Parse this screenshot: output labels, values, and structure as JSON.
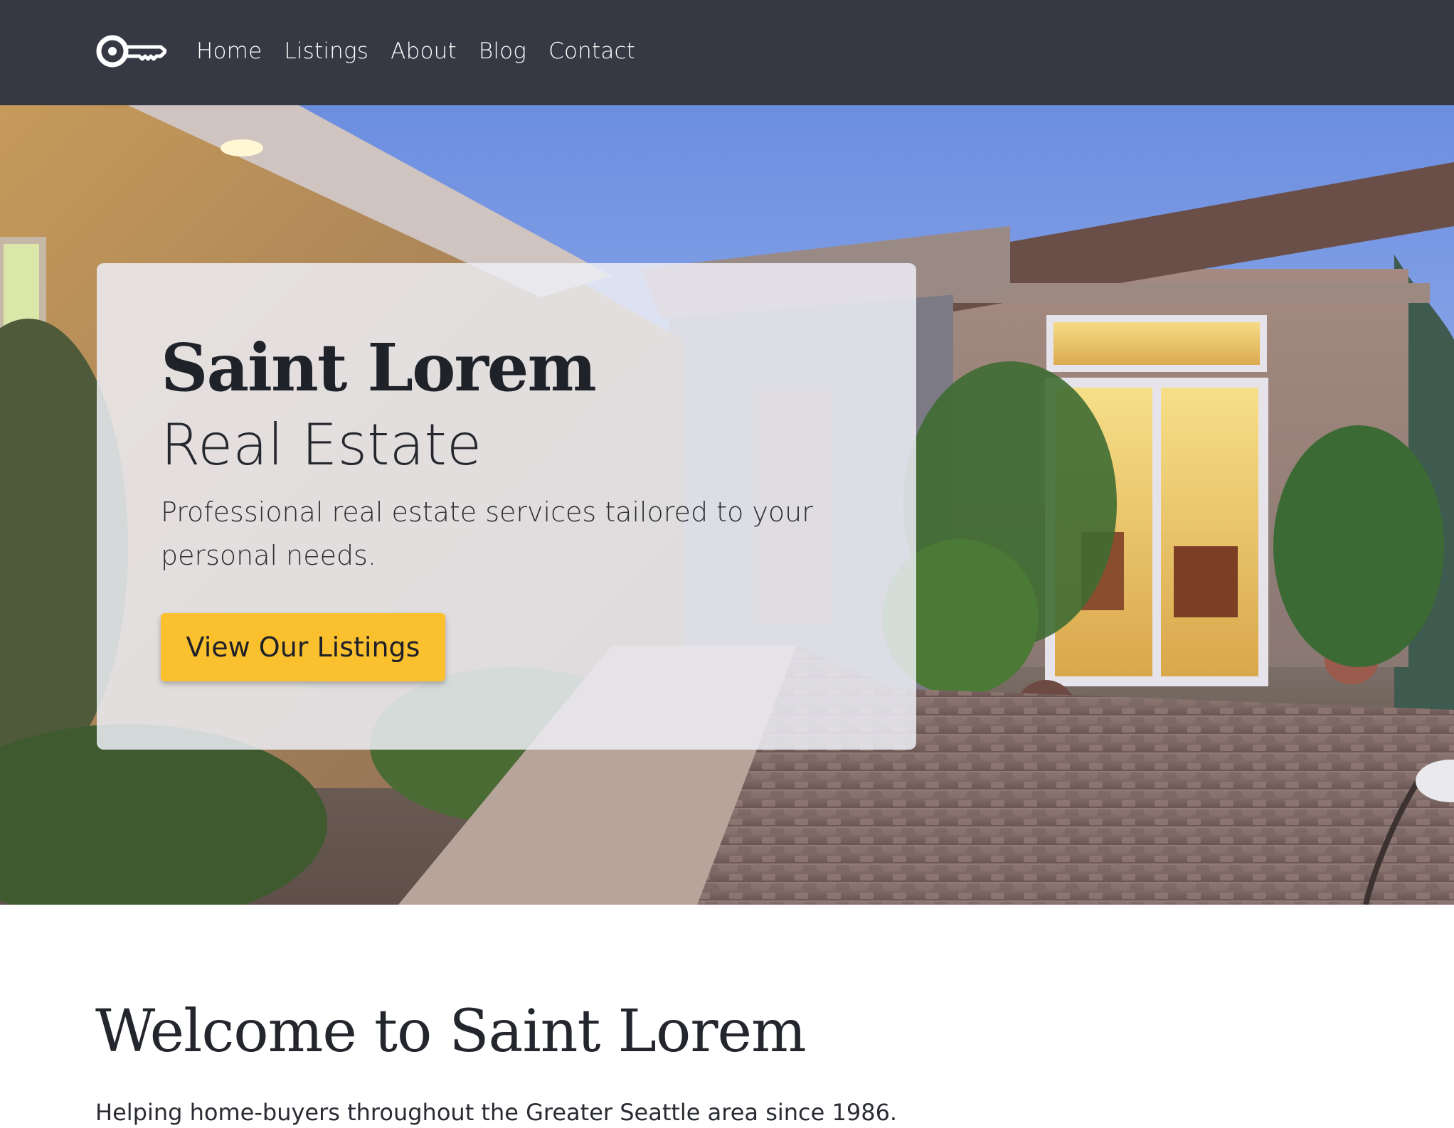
{
  "nav": {
    "logo_icon": "key-icon",
    "links": [
      {
        "label": "Home"
      },
      {
        "label": "Listings"
      },
      {
        "label": "About"
      },
      {
        "label": "Blog"
      },
      {
        "label": "Contact"
      }
    ]
  },
  "hero": {
    "image": "house-exterior-photo",
    "title": "Saint Lorem",
    "subtitle": "Real Estate",
    "text": "Professional real estate services tailored to your personal needs.",
    "button_label": "View Our Listings"
  },
  "welcome": {
    "title": "Welcome to Saint Lorem",
    "text": "Helping home-buyers throughout the Greater Seattle area since 1986."
  },
  "colors": {
    "navbar_bg": "#363844",
    "button_bg": "#fbc02d",
    "text_dark": "#24262d"
  }
}
